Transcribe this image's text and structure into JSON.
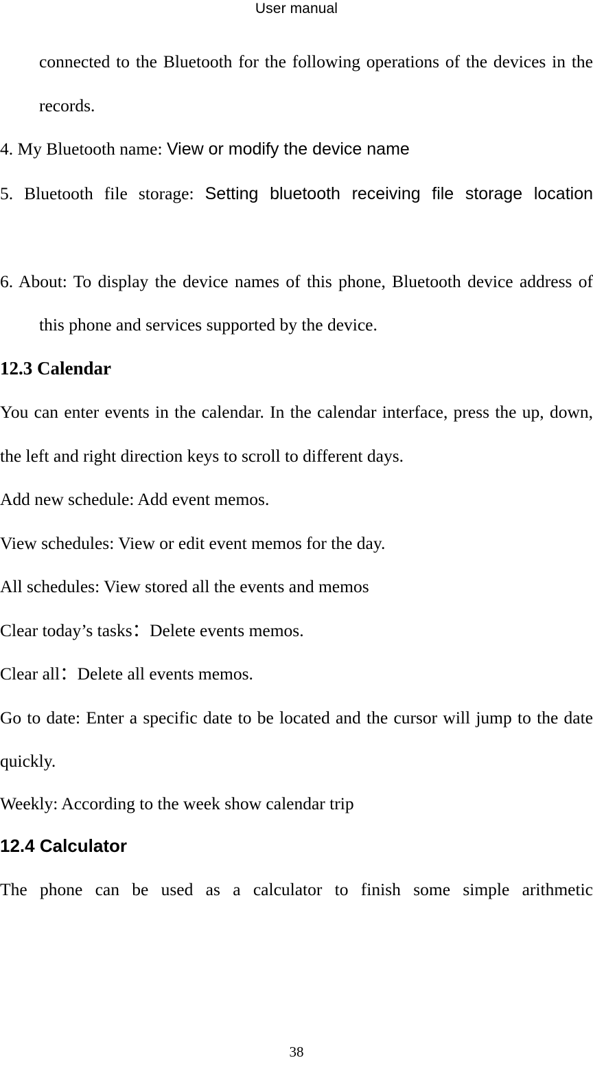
{
  "document": {
    "header": "User manual",
    "page_number": "38"
  },
  "body": {
    "bt_item3_continued": "connected to the Bluetooth for the following operations of the devices in the records.",
    "bt_item4_label": "4. My Bluetooth name: ",
    "bt_item4_value": "View or modify the device name",
    "bt_item5_label": "5. Bluetooth file storage: ",
    "bt_item5_value": "Setting bluetooth receiving file storage location",
    "bt_item6": "6. About: To display the device names of this phone, Bluetooth device address of this phone and services supported by the device."
  },
  "sections": [
    {
      "heading": "12.3 Calendar",
      "heading_style": "serif",
      "paragraphs": [
        "You can enter events in the calendar. In the calendar interface, press the up, down, the left and right direction keys to scroll to different days.",
        "Add new schedule: Add event memos.",
        "View schedules: View or edit event memos for the day.",
        "All schedules: View stored all the events and memos",
        "Clear today’s tasks：Delete events memos.",
        "Clear all：Delete all events memos.",
        "Go to date: Enter a specific date to be located and the cursor will jump to the date quickly.",
        "Weekly: According to the week show calendar trip"
      ]
    },
    {
      "heading": "12.4 Calculator",
      "heading_style": "sans",
      "paragraphs": [
        "The phone can be used as a calculator to finish some simple arithmetic"
      ]
    }
  ]
}
